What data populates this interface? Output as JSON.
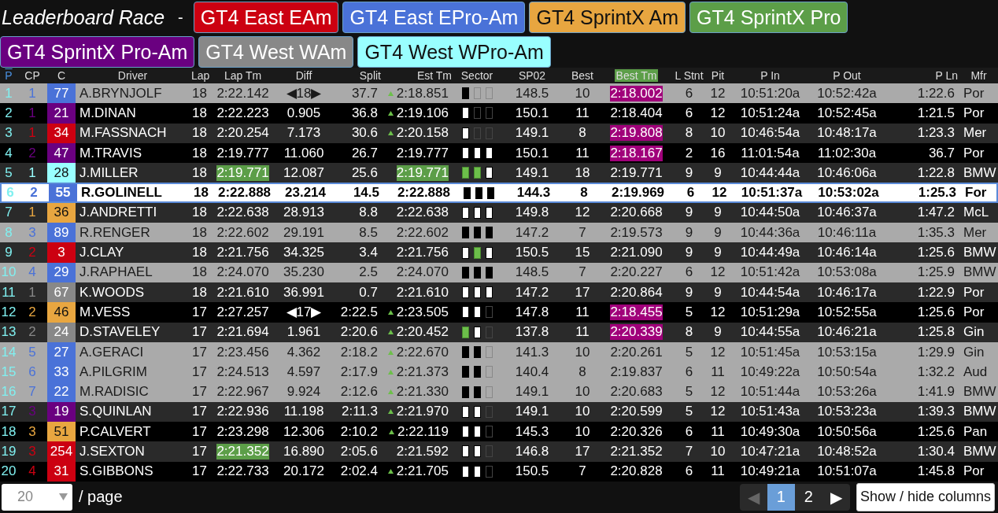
{
  "title": "Leaderboard Race",
  "separator": "-",
  "classes": [
    {
      "label": "GT4 East EAm",
      "color": "#cc0011"
    },
    {
      "label": "GT4 East EPro-Am",
      "color": "#4a72d8"
    },
    {
      "label": "GT4 SprintX Am",
      "color": "#e8a640"
    },
    {
      "label": "GT4 SprintX Pro",
      "color": "#5c9e48"
    },
    {
      "label": "GT4 SprintX Pro-Am",
      "color": "#6a0080"
    },
    {
      "label": "GT4 West WAm",
      "color": "#888888"
    },
    {
      "label": "GT4 West WPro-Am",
      "color": "#99ffff"
    }
  ],
  "columns": [
    {
      "label": "P",
      "sorted": true,
      "highlighted": false
    },
    {
      "label": "CP",
      "sorted": false,
      "highlighted": false
    },
    {
      "label": "C",
      "sorted": false,
      "highlighted": false
    },
    {
      "label": "Driver",
      "sorted": false,
      "highlighted": false
    },
    {
      "label": "Lap",
      "sorted": false,
      "highlighted": false
    },
    {
      "label": "Lap Tm",
      "sorted": false,
      "highlighted": false
    },
    {
      "label": "Diff",
      "sorted": false,
      "highlighted": false
    },
    {
      "label": "Split",
      "sorted": false,
      "highlighted": false
    },
    {
      "label": "Est Tm",
      "sorted": false,
      "highlighted": false
    },
    {
      "label": "Sector",
      "sorted": false,
      "highlighted": false
    },
    {
      "label": "SP02",
      "sorted": false,
      "highlighted": false
    },
    {
      "label": "Best",
      "sorted": false,
      "highlighted": false
    },
    {
      "label": "Best Tm",
      "sorted": false,
      "highlighted": true
    },
    {
      "label": "L Stnt",
      "sorted": false,
      "highlighted": false
    },
    {
      "label": "Pit",
      "sorted": false,
      "highlighted": false
    },
    {
      "label": "P In",
      "sorted": false,
      "highlighted": false
    },
    {
      "label": "P Out",
      "sorted": false,
      "highlighted": false
    },
    {
      "label": "P Ln",
      "sorted": false,
      "highlighted": false
    },
    {
      "label": "Mfr",
      "sorted": false,
      "highlighted": false
    }
  ],
  "rows": [
    {
      "kind": "light",
      "selected": false,
      "p": "1",
      "cp": "1",
      "car": "77",
      "color": "#4a72d8",
      "driver": "A.BRYNJOLF",
      "lap": "18",
      "lap_tm": "2:22.142",
      "lap_tm_best": false,
      "diff": "◀18▶",
      "split": "37.7",
      "est_up": true,
      "est_tm": "2:18.851",
      "est_tm_best": false,
      "sector": [
        {
          "kind": "black"
        },
        {
          "kind": "empty"
        },
        {
          "kind": "empty"
        }
      ],
      "sp02": "148.5",
      "best": "10",
      "best_tm": "2:18.002",
      "best_tm_overall": true,
      "l_stnt": "6",
      "pit": "12",
      "p_in": "10:51:20a",
      "p_out": "10:52:42a",
      "p_ln": "1:22.6",
      "mfr": "Por"
    },
    {
      "kind": "black",
      "selected": false,
      "p": "2",
      "cp": "1",
      "car": "21",
      "color": "#6a0080",
      "driver": "M.DINAN",
      "lap": "18",
      "lap_tm": "2:22.223",
      "lap_tm_best": false,
      "diff": "0.905",
      "split": "36.8",
      "est_up": true,
      "est_tm": "2:19.106",
      "est_tm_best": false,
      "sector": [
        {
          "kind": "white"
        },
        {
          "kind": "empty"
        },
        {
          "kind": "empty"
        }
      ],
      "sp02": "150.1",
      "best": "11",
      "best_tm": "2:18.404",
      "best_tm_overall": false,
      "l_stnt": "6",
      "pit": "12",
      "p_in": "10:51:24a",
      "p_out": "10:52:45a",
      "p_ln": "1:21.5",
      "mfr": "Por"
    },
    {
      "kind": "dark",
      "selected": false,
      "p": "3",
      "cp": "1",
      "car": "34",
      "color": "#cc0011",
      "driver": "M.FASSNACH",
      "lap": "18",
      "lap_tm": "2:20.254",
      "lap_tm_best": false,
      "diff": "7.173",
      "split": "30.6",
      "est_up": true,
      "est_tm": "2:20.158",
      "est_tm_best": false,
      "sector": [
        {
          "kind": "white"
        },
        {
          "kind": "empty"
        },
        {
          "kind": "empty"
        }
      ],
      "sp02": "149.1",
      "best": "8",
      "best_tm": "2:19.808",
      "best_tm_overall": true,
      "l_stnt": "8",
      "pit": "10",
      "p_in": "10:46:54a",
      "p_out": "10:48:17a",
      "p_ln": "1:23.3",
      "mfr": "Mer"
    },
    {
      "kind": "black",
      "selected": false,
      "p": "4",
      "cp": "2",
      "car": "47",
      "color": "#6a0080",
      "driver": "M.TRAVIS",
      "lap": "18",
      "lap_tm": "2:19.777",
      "lap_tm_best": false,
      "diff": "11.060",
      "split": "26.7",
      "est_up": false,
      "est_tm": "2:19.777",
      "est_tm_best": false,
      "sector": [
        {
          "kind": "white"
        },
        {
          "kind": "white"
        },
        {
          "kind": "white"
        }
      ],
      "sp02": "150.1",
      "best": "11",
      "best_tm": "2:18.167",
      "best_tm_overall": true,
      "l_stnt": "2",
      "pit": "16",
      "p_in": "11:01:54a",
      "p_out": "11:02:30a",
      "p_ln": "36.7",
      "mfr": "Por"
    },
    {
      "kind": "dark",
      "selected": false,
      "p": "5",
      "cp": "1",
      "car": "28",
      "color": "#99ffff",
      "driver": "J.MILLER",
      "lap": "18",
      "lap_tm": "2:19.771",
      "lap_tm_best": true,
      "diff": "12.087",
      "split": "25.6",
      "est_up": false,
      "est_tm": "2:19.771",
      "est_tm_best": true,
      "sector": [
        {
          "kind": "green"
        },
        {
          "kind": "green"
        },
        {
          "kind": "white"
        }
      ],
      "sp02": "149.1",
      "best": "18",
      "best_tm": "2:19.771",
      "best_tm_overall": false,
      "l_stnt": "9",
      "pit": "9",
      "p_in": "10:44:44a",
      "p_out": "10:46:06a",
      "p_ln": "1:22.8",
      "mfr": "BMW"
    },
    {
      "kind": "dark",
      "selected": true,
      "p": "6",
      "cp": "2",
      "car": "55",
      "color": "#4a72d8",
      "driver": "R.GOLINELL",
      "lap": "18",
      "lap_tm": "2:22.888",
      "lap_tm_best": false,
      "diff": "23.214",
      "split": "14.5",
      "est_up": false,
      "est_tm": "2:22.888",
      "est_tm_best": false,
      "sector": [
        {
          "kind": "black"
        },
        {
          "kind": "black"
        },
        {
          "kind": "black"
        }
      ],
      "sp02": "144.3",
      "best": "8",
      "best_tm": "2:19.969",
      "best_tm_overall": false,
      "l_stnt": "6",
      "pit": "12",
      "p_in": "10:51:37a",
      "p_out": "10:53:02a",
      "p_ln": "1:25.3",
      "mfr": "For"
    },
    {
      "kind": "dark",
      "selected": false,
      "p": "7",
      "cp": "1",
      "car": "36",
      "color": "#e8a640",
      "driver": "J.ANDRETTI",
      "lap": "18",
      "lap_tm": "2:22.638",
      "lap_tm_best": false,
      "diff": "28.913",
      "split": "8.8",
      "est_up": false,
      "est_tm": "2:22.638",
      "est_tm_best": false,
      "sector": [
        {
          "kind": "white"
        },
        {
          "kind": "white"
        },
        {
          "kind": "white"
        }
      ],
      "sp02": "149.8",
      "best": "12",
      "best_tm": "2:20.668",
      "best_tm_overall": false,
      "l_stnt": "9",
      "pit": "9",
      "p_in": "10:44:50a",
      "p_out": "10:46:37a",
      "p_ln": "1:47.2",
      "mfr": "McL"
    },
    {
      "kind": "light",
      "selected": false,
      "p": "8",
      "cp": "3",
      "car": "89",
      "color": "#4a72d8",
      "driver": "R.RENGER",
      "lap": "18",
      "lap_tm": "2:22.602",
      "lap_tm_best": false,
      "diff": "29.191",
      "split": "8.5",
      "est_up": false,
      "est_tm": "2:22.602",
      "est_tm_best": false,
      "sector": [
        {
          "kind": "black"
        },
        {
          "kind": "black"
        },
        {
          "kind": "black"
        }
      ],
      "sp02": "147.2",
      "best": "7",
      "best_tm": "2:19.573",
      "best_tm_overall": false,
      "l_stnt": "9",
      "pit": "9",
      "p_in": "10:44:36a",
      "p_out": "10:46:11a",
      "p_ln": "1:35.3",
      "mfr": "Mer"
    },
    {
      "kind": "dark",
      "selected": false,
      "p": "9",
      "cp": "2",
      "car": "3",
      "color": "#cc0011",
      "driver": "J.CLAY",
      "lap": "18",
      "lap_tm": "2:21.756",
      "lap_tm_best": false,
      "diff": "34.325",
      "split": "3.4",
      "est_up": false,
      "est_tm": "2:21.756",
      "est_tm_best": false,
      "sector": [
        {
          "kind": "white"
        },
        {
          "kind": "green"
        },
        {
          "kind": "white"
        }
      ],
      "sp02": "150.5",
      "best": "15",
      "best_tm": "2:21.090",
      "best_tm_overall": false,
      "l_stnt": "9",
      "pit": "9",
      "p_in": "10:44:49a",
      "p_out": "10:46:14a",
      "p_ln": "1:25.6",
      "mfr": "BMW"
    },
    {
      "kind": "light",
      "selected": false,
      "p": "10",
      "cp": "4",
      "car": "29",
      "color": "#4a72d8",
      "driver": "J.RAPHAEL",
      "lap": "18",
      "lap_tm": "2:24.070",
      "lap_tm_best": false,
      "diff": "35.230",
      "split": "2.5",
      "est_up": false,
      "est_tm": "2:24.070",
      "est_tm_best": false,
      "sector": [
        {
          "kind": "black"
        },
        {
          "kind": "black"
        },
        {
          "kind": "black"
        }
      ],
      "sp02": "148.5",
      "best": "7",
      "best_tm": "2:20.227",
      "best_tm_overall": false,
      "l_stnt": "6",
      "pit": "12",
      "p_in": "10:51:42a",
      "p_out": "10:53:08a",
      "p_ln": "1:25.9",
      "mfr": "BMW"
    },
    {
      "kind": "dark",
      "selected": false,
      "p": "11",
      "cp": "1",
      "car": "67",
      "color": "#888888",
      "driver": "K.WOODS",
      "lap": "18",
      "lap_tm": "2:21.610",
      "lap_tm_best": false,
      "diff": "36.991",
      "split": "0.7",
      "est_up": false,
      "est_tm": "2:21.610",
      "est_tm_best": false,
      "sector": [
        {
          "kind": "white"
        },
        {
          "kind": "white"
        },
        {
          "kind": "white"
        }
      ],
      "sp02": "147.2",
      "best": "17",
      "best_tm": "2:20.864",
      "best_tm_overall": false,
      "l_stnt": "9",
      "pit": "9",
      "p_in": "10:44:54a",
      "p_out": "10:46:17a",
      "p_ln": "1:22.9",
      "mfr": "Por"
    },
    {
      "kind": "black",
      "selected": false,
      "p": "12",
      "cp": "2",
      "car": "46",
      "color": "#e8a640",
      "driver": "M.VESS",
      "lap": "17",
      "lap_tm": "2:27.257",
      "lap_tm_best": false,
      "diff": "◀17▶",
      "split": "2:22.5",
      "est_up": true,
      "est_tm": "2:23.505",
      "est_tm_best": false,
      "sector": [
        {
          "kind": "white"
        },
        {
          "kind": "white"
        },
        {
          "kind": "empty"
        }
      ],
      "sp02": "147.8",
      "best": "11",
      "best_tm": "2:18.455",
      "best_tm_overall": true,
      "l_stnt": "5",
      "pit": "12",
      "p_in": "10:51:29a",
      "p_out": "10:52:55a",
      "p_ln": "1:25.6",
      "mfr": "Por"
    },
    {
      "kind": "dark",
      "selected": false,
      "p": "13",
      "cp": "2",
      "car": "24",
      "color": "#888888",
      "driver": "D.STAVELEY",
      "lap": "17",
      "lap_tm": "2:21.694",
      "lap_tm_best": false,
      "diff": "1.961",
      "split": "2:20.6",
      "est_up": true,
      "est_tm": "2:20.452",
      "est_tm_best": false,
      "sector": [
        {
          "kind": "green"
        },
        {
          "kind": "white"
        },
        {
          "kind": "empty"
        }
      ],
      "sp02": "137.8",
      "best": "11",
      "best_tm": "2:20.339",
      "best_tm_overall": true,
      "l_stnt": "8",
      "pit": "9",
      "p_in": "10:44:55a",
      "p_out": "10:46:21a",
      "p_ln": "1:25.8",
      "mfr": "Gin"
    },
    {
      "kind": "light",
      "selected": false,
      "p": "14",
      "cp": "5",
      "car": "27",
      "color": "#4a72d8",
      "driver": "A.GERACI",
      "lap": "17",
      "lap_tm": "2:23.456",
      "lap_tm_best": false,
      "diff": "4.362",
      "split": "2:18.2",
      "est_up": true,
      "est_tm": "2:22.670",
      "est_tm_best": false,
      "sector": [
        {
          "kind": "black"
        },
        {
          "kind": "black"
        },
        {
          "kind": "empty"
        }
      ],
      "sp02": "141.3",
      "best": "10",
      "best_tm": "2:20.261",
      "best_tm_overall": false,
      "l_stnt": "5",
      "pit": "12",
      "p_in": "10:51:45a",
      "p_out": "10:53:15a",
      "p_ln": "1:29.9",
      "mfr": "Gin"
    },
    {
      "kind": "light",
      "selected": false,
      "p": "15",
      "cp": "6",
      "car": "33",
      "color": "#4a72d8",
      "driver": "A.PILGRIM",
      "lap": "17",
      "lap_tm": "2:24.513",
      "lap_tm_best": false,
      "diff": "4.597",
      "split": "2:17.9",
      "est_up": true,
      "est_tm": "2:21.373",
      "est_tm_best": false,
      "sector": [
        {
          "kind": "black"
        },
        {
          "kind": "black"
        },
        {
          "kind": "empty"
        }
      ],
      "sp02": "140.4",
      "best": "8",
      "best_tm": "2:19.837",
      "best_tm_overall": false,
      "l_stnt": "6",
      "pit": "11",
      "p_in": "10:49:22a",
      "p_out": "10:50:54a",
      "p_ln": "1:32.2",
      "mfr": "Aud"
    },
    {
      "kind": "light",
      "selected": false,
      "p": "16",
      "cp": "7",
      "car": "22",
      "color": "#4a72d8",
      "driver": "M.RADISIC",
      "lap": "17",
      "lap_tm": "2:22.967",
      "lap_tm_best": false,
      "diff": "9.924",
      "split": "2:12.6",
      "est_up": true,
      "est_tm": "2:21.330",
      "est_tm_best": false,
      "sector": [
        {
          "kind": "black"
        },
        {
          "kind": "black"
        },
        {
          "kind": "empty"
        }
      ],
      "sp02": "149.1",
      "best": "10",
      "best_tm": "2:20.683",
      "best_tm_overall": false,
      "l_stnt": "5",
      "pit": "12",
      "p_in": "10:51:44a",
      "p_out": "10:53:26a",
      "p_ln": "1:41.9",
      "mfr": "BMW"
    },
    {
      "kind": "dark",
      "selected": false,
      "p": "17",
      "cp": "3",
      "car": "19",
      "color": "#6a0080",
      "driver": "S.QUINLAN",
      "lap": "17",
      "lap_tm": "2:22.936",
      "lap_tm_best": false,
      "diff": "11.198",
      "split": "2:11.3",
      "est_up": true,
      "est_tm": "2:21.970",
      "est_tm_best": false,
      "sector": [
        {
          "kind": "white"
        },
        {
          "kind": "white"
        },
        {
          "kind": "empty"
        }
      ],
      "sp02": "149.1",
      "best": "10",
      "best_tm": "2:20.599",
      "best_tm_overall": false,
      "l_stnt": "5",
      "pit": "12",
      "p_in": "10:51:43a",
      "p_out": "10:53:23a",
      "p_ln": "1:39.3",
      "mfr": "BMW"
    },
    {
      "kind": "black",
      "selected": false,
      "p": "18",
      "cp": "3",
      "car": "51",
      "color": "#e8a640",
      "driver": "P.CALVERT",
      "lap": "17",
      "lap_tm": "2:23.298",
      "lap_tm_best": false,
      "diff": "12.306",
      "split": "2:10.2",
      "est_up": true,
      "est_tm": "2:22.119",
      "est_tm_best": false,
      "sector": [
        {
          "kind": "white"
        },
        {
          "kind": "white"
        },
        {
          "kind": "empty"
        }
      ],
      "sp02": "145.3",
      "best": "10",
      "best_tm": "2:20.326",
      "best_tm_overall": false,
      "l_stnt": "6",
      "pit": "11",
      "p_in": "10:49:30a",
      "p_out": "10:50:56a",
      "p_ln": "1:25.6",
      "mfr": "Pan"
    },
    {
      "kind": "dark",
      "selected": false,
      "p": "19",
      "cp": "3",
      "car": "254",
      "color": "#cc0011",
      "driver": "J.SEXTON",
      "lap": "17",
      "lap_tm": "2:21.352",
      "lap_tm_best": true,
      "diff": "16.890",
      "split": "2:05.6",
      "est_up": false,
      "est_tm": "2:21.592",
      "est_tm_best": false,
      "sector": [
        {
          "kind": "white"
        },
        {
          "kind": "white"
        },
        {
          "kind": "empty"
        }
      ],
      "sp02": "146.8",
      "best": "17",
      "best_tm": "2:21.352",
      "best_tm_overall": false,
      "l_stnt": "7",
      "pit": "10",
      "p_in": "10:47:21a",
      "p_out": "10:48:52a",
      "p_ln": "1:30.4",
      "mfr": "BMW"
    },
    {
      "kind": "black",
      "selected": false,
      "p": "20",
      "cp": "4",
      "car": "31",
      "color": "#cc0011",
      "driver": "S.GIBBONS",
      "lap": "17",
      "lap_tm": "2:22.733",
      "lap_tm_best": false,
      "diff": "20.172",
      "split": "2:02.4",
      "est_up": true,
      "est_tm": "2:21.705",
      "est_tm_best": false,
      "sector": [
        {
          "kind": "white"
        },
        {
          "kind": "white"
        },
        {
          "kind": "empty"
        }
      ],
      "sp02": "150.5",
      "best": "7",
      "best_tm": "2:20.828",
      "best_tm_overall": false,
      "l_stnt": "6",
      "pit": "11",
      "p_in": "10:49:21a",
      "p_out": "10:51:07a",
      "p_ln": "1:45.8",
      "mfr": "Por"
    }
  ],
  "footer": {
    "page_size": "20",
    "page_label": "/ page",
    "prev": "◀",
    "prev_disabled": true,
    "pages": [
      {
        "label": "1",
        "selected": true
      },
      {
        "label": "2",
        "selected": false
      }
    ],
    "next": "▶",
    "columns_button": "Show / hide columns"
  }
}
